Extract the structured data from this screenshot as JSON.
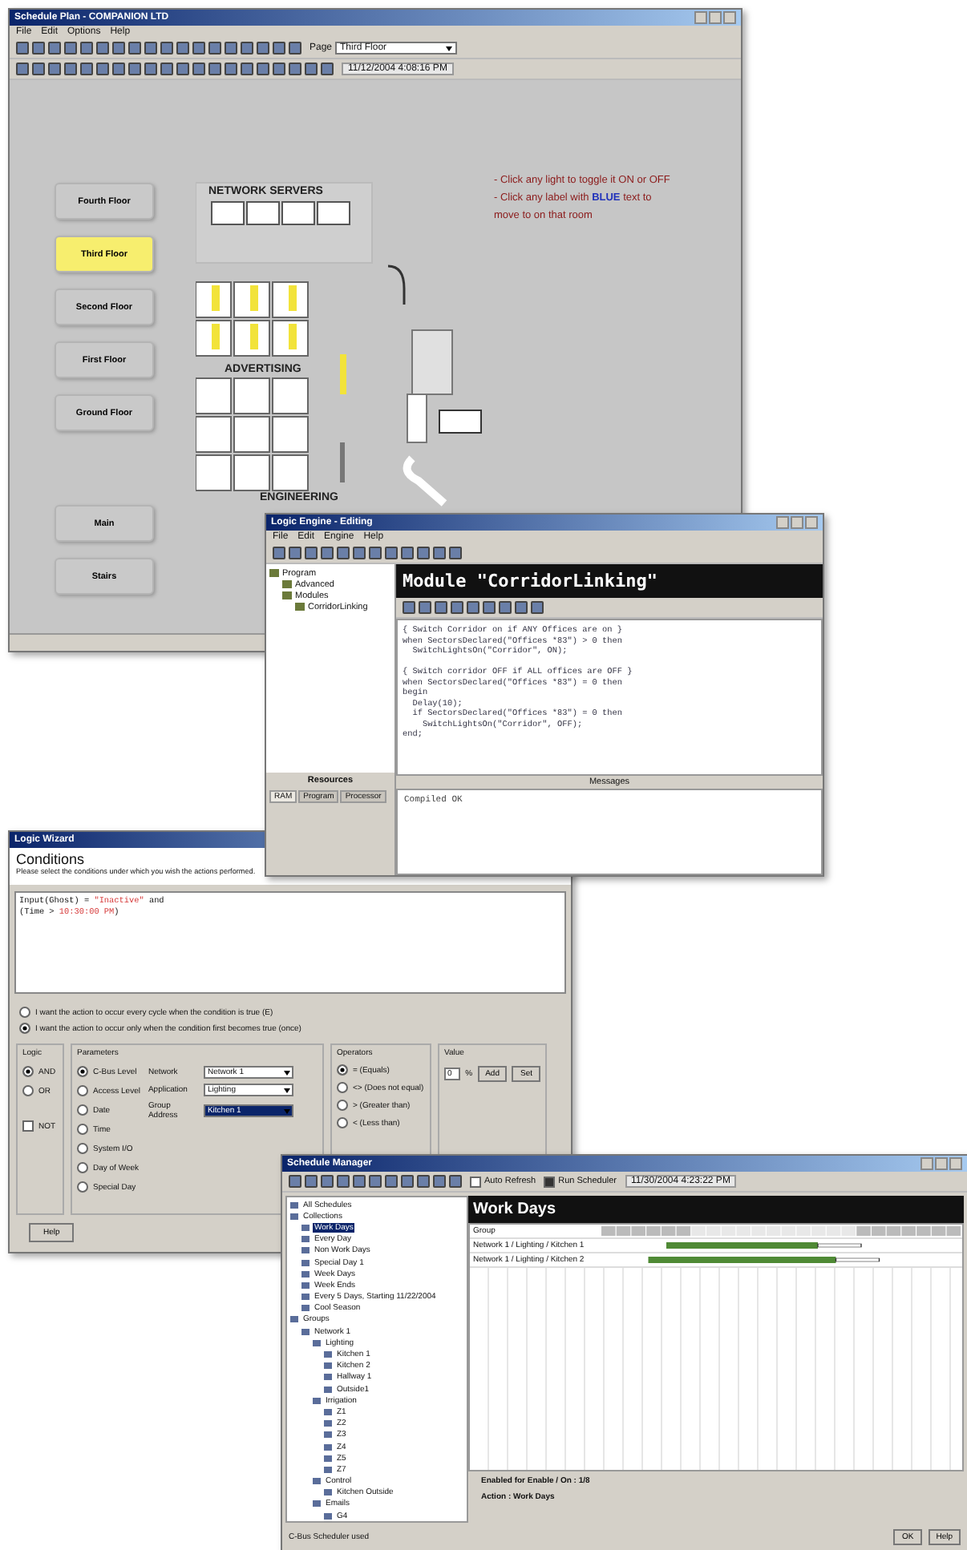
{
  "plan_window": {
    "title": "Schedule Plan - COMPANION LTD",
    "menus": [
      "File",
      "Edit",
      "Options",
      "Help"
    ],
    "page_label": "Page",
    "page_value": "Third Floor",
    "timestamp": "11/12/2004 4:08:16 PM",
    "floors": [
      {
        "label": "Fourth Floor",
        "selected": false
      },
      {
        "label": "Third Floor",
        "selected": true
      },
      {
        "label": "Second Floor",
        "selected": false
      },
      {
        "label": "First Floor",
        "selected": false
      },
      {
        "label": "Ground Floor",
        "selected": false
      }
    ],
    "areas": [
      {
        "label": "Main",
        "selected": false
      },
      {
        "label": "Stairs",
        "selected": false
      }
    ],
    "room_labels": [
      "NETWORK SERVERS",
      "ADVERTISING",
      "ENGINEERING"
    ],
    "instructions": [
      "- Click any light to toggle it ON or OFF",
      "- Click any label with **BLUE** text to",
      "move to on that room"
    ]
  },
  "logic_window": {
    "title": "Logic Engine - Editing",
    "menus": [
      "File",
      "Edit",
      "Engine",
      "Help"
    ],
    "tree": [
      {
        "label": "Program",
        "children": [
          {
            "label": "Advanced"
          },
          {
            "label": "Modules",
            "children": [
              {
                "label": "CorridorLinking"
              }
            ]
          }
        ]
      }
    ],
    "module_title": "Module \"CorridorLinking\"",
    "code_blocks": [
      [
        "{ Switch Corridor on if ANY Offices are on }",
        "when SectorsDeclared(\"Offices *83\") > 0 then",
        "  SwitchLightsOn(\"Corridor\", ON);"
      ],
      [
        "{ Switch corridor OFF if ALL offices are OFF }",
        "when SectorsDeclared(\"Offices *83\") = 0 then",
        "begin",
        "  Delay(10);",
        "  if SectorsDeclared(\"Offices *83\") = 0 then",
        "    SwitchLightsOn(\"Corridor\", OFF);",
        "end;"
      ]
    ],
    "resources_title": "Resources",
    "resource_tabs": [
      {
        "label": "RAM",
        "selected": true
      },
      {
        "label": "Program",
        "selected": false
      },
      {
        "label": "Processor",
        "selected": false
      }
    ],
    "messages_title": "Messages",
    "message": "Compiled OK"
  },
  "wizard": {
    "title": "Logic Wizard",
    "heading": "Conditions",
    "subtitle": "Please select the conditions under which you wish the actions performed.",
    "code": [
      {
        "text": "Input(Ghost) = ",
        "value": "\"Inactive\"",
        "tail": " and"
      },
      {
        "text": "(Time > ",
        "value": "10:30:00 PM",
        "tail": ")"
      }
    ],
    "modes": [
      {
        "label": "I want the action to occur every cycle when the condition is true (E)",
        "selected": false
      },
      {
        "label": "I want the action to occur only when the condition first becomes true (once)",
        "selected": true
      }
    ],
    "logic_title": "Logic",
    "logic": [
      {
        "label": "AND",
        "selected": true
      },
      {
        "label": "OR",
        "selected": false
      }
    ],
    "not": {
      "label": "NOT",
      "checked": false
    },
    "parameters_title": "Parameters",
    "parameters": [
      {
        "label": "C-Bus Level",
        "selected": true
      },
      {
        "label": "Access Level",
        "selected": false
      },
      {
        "label": "Date",
        "selected": false
      },
      {
        "label": "Time",
        "selected": false
      },
      {
        "label": "System I/O",
        "selected": false
      },
      {
        "label": "Day of Week",
        "selected": false
      },
      {
        "label": "Special Day",
        "selected": false
      }
    ],
    "fields": [
      {
        "label": "Network",
        "value": "Network 1",
        "highlighted": false
      },
      {
        "label": "Application",
        "value": "Lighting",
        "highlighted": false
      },
      {
        "label": "Group Address",
        "value": "Kitchen 1",
        "highlighted": true
      }
    ],
    "operators_title": "Operators",
    "operators": [
      {
        "label": "= (Equals)",
        "selected": true
      },
      {
        "label": "<> (Does not equal)",
        "selected": false
      },
      {
        "label": "> (Greater than)",
        "selected": false
      },
      {
        "label": "< (Less than)",
        "selected": false
      }
    ],
    "value_title": "Value",
    "value": "0",
    "unit": "%",
    "value_buttons": [
      "Add",
      "Set"
    ],
    "help": "Help"
  },
  "schedule": {
    "title": "Schedule Manager",
    "options": [
      {
        "label": "Auto Refresh",
        "checked": false
      },
      {
        "label": "Run Scheduler",
        "checked": true
      }
    ],
    "timestamp": "11/30/2004 4:23:22 PM",
    "tree": [
      {
        "label": "All Schedules",
        "selected": false
      },
      {
        "label": "Collections",
        "selected": false,
        "children": [
          {
            "label": "Work Days",
            "selected": true
          },
          {
            "label": "Every Day",
            "selected": false
          },
          {
            "label": "Non Work Days",
            "selected": false
          },
          {
            "label": "Special Day 1",
            "selected": false
          },
          {
            "label": "Week Days",
            "selected": false
          },
          {
            "label": "Week Ends",
            "selected": false
          },
          {
            "label": "Every 5 Days, Starting 11/22/2004",
            "selected": false
          },
          {
            "label": "Cool Season",
            "selected": false
          }
        ]
      },
      {
        "label": "Groups",
        "selected": false,
        "children": [
          {
            "label": "Network 1",
            "selected": false,
            "children": [
              {
                "label": "Lighting",
                "selected": false,
                "children": [
                  {
                    "label": "Kitchen 1",
                    "selected": false
                  },
                  {
                    "label": "Kitchen 2",
                    "selected": false
                  },
                  {
                    "label": "Hallway 1",
                    "selected": false
                  },
                  {
                    "label": "Outside1",
                    "selected": false
                  }
                ]
              },
              {
                "label": "Irrigation",
                "selected": false,
                "children": [
                  {
                    "label": "Z1",
                    "selected": false
                  },
                  {
                    "label": "Z2",
                    "selected": false
                  },
                  {
                    "label": "Z3",
                    "selected": false
                  },
                  {
                    "label": "Z4",
                    "selected": false
                  },
                  {
                    "label": "Z5",
                    "selected": false
                  },
                  {
                    "label": "Z7",
                    "selected": false
                  }
                ]
              },
              {
                "label": "Control",
                "selected": false,
                "children": [
                  {
                    "label": "Kitchen Outside",
                    "selected": false
                  }
                ]
              },
              {
                "label": "Emails",
                "selected": false,
                "children": [
                  {
                    "label": "G4",
                    "selected": false
                  }
                ]
              }
            ]
          }
        ]
      }
    ],
    "header": "Work Days",
    "group_column": "Group",
    "rows": [
      "Network 1 / Lighting / Kitchen 1",
      "Network 1 / Lighting / Kitchen 2"
    ],
    "footer": [
      "Enabled for Enable / On : 1/8",
      "Action : Work Days"
    ],
    "status": "C-Bus Scheduler used",
    "buttons": [
      "OK",
      "Help"
    ]
  }
}
